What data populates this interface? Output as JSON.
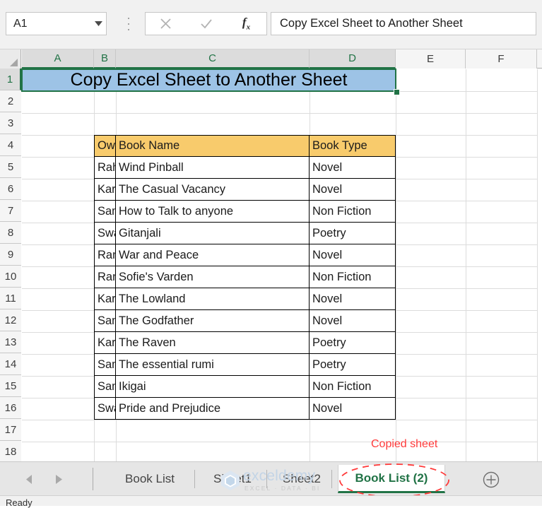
{
  "app": {
    "name_box_value": "A1",
    "formula_bar_value": "Copy Excel Sheet to Another Sheet",
    "cancel_icon": "close-icon",
    "confirm_icon": "check-icon",
    "function_icon": "fx-icon",
    "dropdown_icon": "chevron-down-icon"
  },
  "grid": {
    "columns": [
      {
        "label": "A",
        "selected": true
      },
      {
        "label": "B",
        "selected": true
      },
      {
        "label": "C",
        "selected": true
      },
      {
        "label": "D",
        "selected": true
      },
      {
        "label": "E",
        "selected": false
      },
      {
        "label": "F",
        "selected": false
      }
    ],
    "rows": [
      "1",
      "2",
      "3",
      "4",
      "5",
      "6",
      "7",
      "8",
      "9",
      "10",
      "11",
      "12",
      "13",
      "14",
      "15",
      "16",
      "17",
      "18"
    ],
    "selected_row": "1",
    "title_cell": {
      "ref": "A1",
      "text": "Copy Excel Sheet to Another Sheet",
      "fill_color": "#9dc3e6",
      "selection_color": "#217346"
    }
  },
  "table": {
    "header_fill": "#f8cb6c",
    "headers": [
      "Owner",
      "Book Name",
      "Book Type"
    ],
    "rows": [
      [
        "Rahim",
        "Wind Pinball",
        "Novel"
      ],
      [
        "Karim",
        "The Casual Vacancy",
        "Novel"
      ],
      [
        "Samia",
        "How to Talk to anyone",
        "Non Fiction"
      ],
      [
        "Swarna",
        "Gitanjali",
        "Poetry"
      ],
      [
        "Ranok",
        "War and Peace",
        "Novel"
      ],
      [
        "Ranok",
        "Sofie's Varden",
        "Non Fiction"
      ],
      [
        "Karim",
        "The Lowland",
        "Novel"
      ],
      [
        "Samia",
        "The Godfather",
        "Novel"
      ],
      [
        "Karim",
        "The Raven",
        "Poetry"
      ],
      [
        "Samia",
        "The essential rumi",
        "Poetry"
      ],
      [
        "Samia",
        "Ikigai",
        "Non Fiction"
      ],
      [
        "Swarna",
        "Pride and Prejudice",
        "Novel"
      ]
    ]
  },
  "tabs": {
    "prev_icon": "arrow-left-icon",
    "next_icon": "arrow-right-icon",
    "add_icon": "plus-circle-icon",
    "items": [
      {
        "label": "Book List",
        "active": false
      },
      {
        "label": "Sheet1",
        "active": false
      },
      {
        "label": "Sheet2",
        "active": false
      },
      {
        "label": "Book List (2)",
        "active": true
      }
    ],
    "active_color": "#217346"
  },
  "annotation": {
    "label": "Copied sheet",
    "color": "#ff3a3a"
  },
  "watermark": {
    "text": "exceldemy",
    "subtitle": "EXCEL · DATA · BI"
  },
  "status": {
    "text": "Ready"
  }
}
